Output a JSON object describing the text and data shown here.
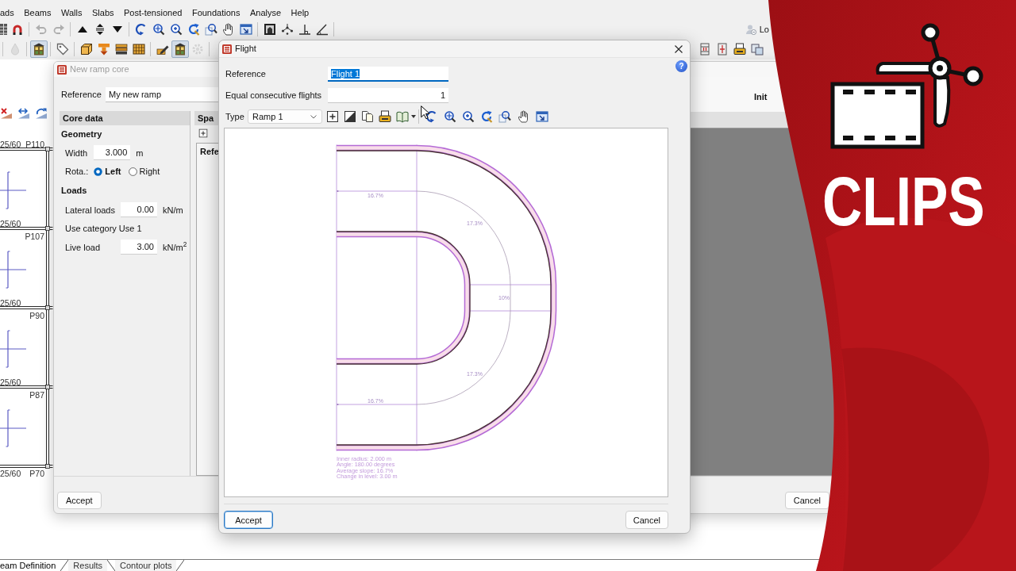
{
  "main_window": {
    "menu": [
      "ads",
      "Beams",
      "Walls",
      "Slabs",
      "Post-tensioned",
      "Foundations",
      "Analyse",
      "Help"
    ],
    "toolbar_1": [
      {
        "disabled": false
      },
      {
        "disabled": false
      },
      {
        "disabled": true
      },
      {
        "disabled": true
      },
      {
        "disabled": false
      },
      {
        "disabled": false
      },
      {
        "disabled": false
      },
      {
        "disabled": false
      },
      {
        "disabled": false
      },
      {
        "disabled": false
      },
      {
        "disabled": false
      },
      {
        "disabled": false
      },
      {
        "disabled": false
      },
      {
        "disabled": false
      },
      {
        "disabled": false
      },
      {
        "disabled": false
      },
      {
        "disabled": false
      },
      {
        "disabled": false
      }
    ],
    "user_label": "Lo",
    "toolbar_2": [
      {
        "pressed": false,
        "disabled": true
      },
      {
        "pressed": true,
        "disabled": false
      },
      {
        "pressed": false,
        "disabled": false
      },
      {
        "pressed": false,
        "disabled": false
      },
      {
        "pressed": false,
        "disabled": false
      },
      {
        "pressed": false,
        "disabled": false
      },
      {
        "pressed": false,
        "disabled": false
      },
      {
        "pressed": false,
        "disabled": false
      },
      {
        "pressed": true,
        "disabled": false
      },
      {
        "pressed": false,
        "disabled": true
      }
    ],
    "plan": {
      "beam_labels": [
        "25/60",
        "25/60",
        "25/60",
        "25/60",
        "25/60"
      ],
      "column_labels": [
        "P110",
        "P107",
        "P90",
        "P87",
        "P70"
      ]
    },
    "bottom_tabs": [
      {
        "label": "eam Definition",
        "selected": true
      },
      {
        "label": "Results",
        "selected": false
      },
      {
        "label": "Contour plots",
        "selected": false
      }
    ]
  },
  "ramp_core_dialog": {
    "title": "New ramp core",
    "active": false,
    "reference": {
      "label": "Reference",
      "value": "My new ramp"
    },
    "core_data": {
      "title": "Core data",
      "sections": [
        {
          "title": "Geometry",
          "rows": [
            {
              "kind": "field",
              "label": "Width",
              "value": "3.000",
              "unit": "m"
            },
            {
              "kind": "radio",
              "label": "Rota.:",
              "options": [
                {
                  "label": "Left",
                  "selected": true
                },
                {
                  "label": "Right",
                  "selected": false
                }
              ]
            }
          ]
        },
        {
          "title": "Loads",
          "rows": [
            {
              "kind": "field",
              "label": "Lateral loads",
              "value": "0.00",
              "unit": "kN/m"
            },
            {
              "kind": "text",
              "label": "Use category",
              "value": "Use 1"
            },
            {
              "kind": "field",
              "label": "Live load",
              "value": "3.00",
              "unit": "kN/m$^{2}$"
            }
          ]
        }
      ]
    },
    "span_panel": {
      "title": "Spa",
      "column_1": "Refe"
    },
    "preview_table": {
      "column_1": "Init"
    },
    "buttons": [
      {
        "label": "Accept"
      },
      {
        "label": "Cancel"
      }
    ]
  },
  "flight_dialog": {
    "title": "Flight",
    "active": true,
    "help": "?",
    "reference": {
      "label": "Reference",
      "value": "Flight 1",
      "focused": true,
      "text_selected": true
    },
    "equal_flights": {
      "label": "Equal consecutive flights",
      "value": "1"
    },
    "type": {
      "label": "Type",
      "value": "Ramp 1"
    },
    "plan": {
      "slope_labels": [
        "16.7%",
        "17.3%",
        "10%",
        "17.3%",
        "16.7%"
      ],
      "summary": [
        "Inner radius: 2.000 m",
        "Angle: 180.00 degrees",
        "Average slope: 16.7%",
        "Change in level: 3.00 m"
      ]
    },
    "buttons": [
      {
        "label": "Accept",
        "default": true
      },
      {
        "label": "Cancel",
        "default": false
      }
    ]
  },
  "banner": {
    "title": "CLIPS"
  }
}
